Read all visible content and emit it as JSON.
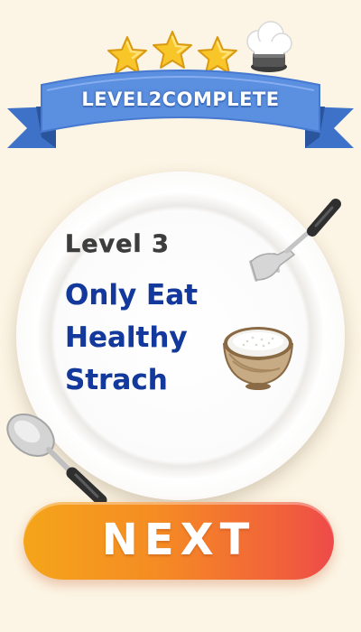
{
  "banner": {
    "title": "LEVEL2COMPLETE",
    "stars_earned": 3,
    "stars_total": 3
  },
  "level": {
    "label": "Level 3",
    "task_lines": [
      "Only Eat",
      "Healthy",
      "Strach"
    ]
  },
  "next_button": {
    "label": "NEXT"
  },
  "colors": {
    "background": "#fcf4e4",
    "ribbon": "#5b8fe0",
    "star": "#f9c62a",
    "task_text": "#13399c",
    "button_start": "#f5a51a",
    "button_end": "#ee4a4a"
  },
  "icons": [
    "star-icon",
    "chef-hat-icon",
    "fork-icon",
    "spoon-icon",
    "rice-bowl-icon"
  ]
}
